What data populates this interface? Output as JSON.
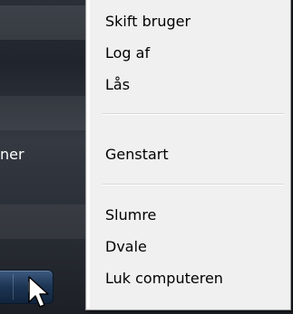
{
  "backdrop": {
    "partial_label": "ner"
  },
  "menu": {
    "groups": [
      [
        "Skift bruger",
        "Log af",
        "Lås"
      ],
      [
        "Genstart"
      ],
      [
        "Slumre",
        "Dvale",
        "Luk computeren"
      ]
    ],
    "items": {
      "switch_user": "Skift bruger",
      "log_off": "Log af",
      "lock": "Lås",
      "restart": "Genstart",
      "sleep": "Slumre",
      "hibernate": "Dvale",
      "shut_down": "Luk computeren"
    }
  },
  "icons": {
    "shutdown_arrow": "chevron-right-icon",
    "cursor": "mouse-pointer-icon"
  },
  "colors": {
    "menu_background": "#f0f0f0",
    "menu_border": "#979797",
    "backdrop": "#2a2e35",
    "shutdown_button": "#1d3554"
  }
}
